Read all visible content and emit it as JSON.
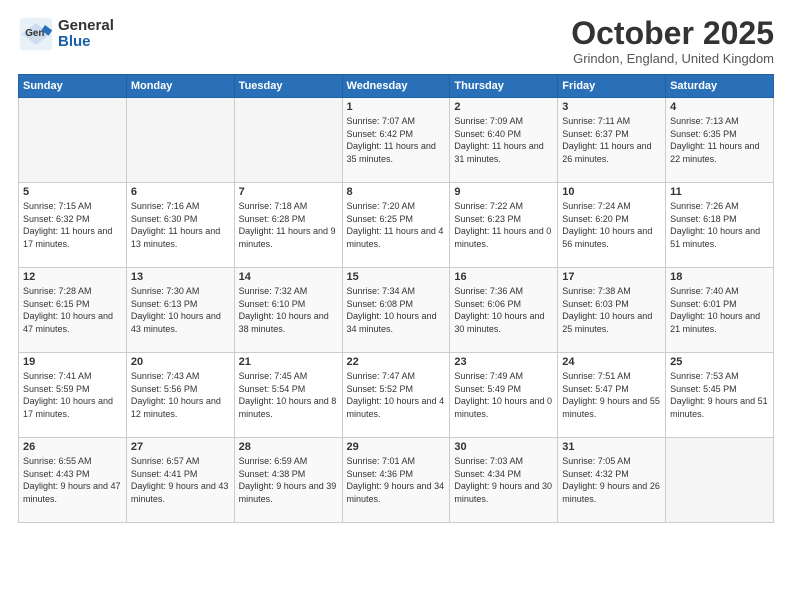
{
  "header": {
    "logo_general": "General",
    "logo_blue": "Blue",
    "month_title": "October 2025",
    "location": "Grindon, England, United Kingdom"
  },
  "days_of_week": [
    "Sunday",
    "Monday",
    "Tuesday",
    "Wednesday",
    "Thursday",
    "Friday",
    "Saturday"
  ],
  "weeks": [
    [
      {
        "day": "",
        "sunrise": "",
        "sunset": "",
        "daylight": ""
      },
      {
        "day": "",
        "sunrise": "",
        "sunset": "",
        "daylight": ""
      },
      {
        "day": "",
        "sunrise": "",
        "sunset": "",
        "daylight": ""
      },
      {
        "day": "1",
        "sunrise": "Sunrise: 7:07 AM",
        "sunset": "Sunset: 6:42 PM",
        "daylight": "Daylight: 11 hours and 35 minutes."
      },
      {
        "day": "2",
        "sunrise": "Sunrise: 7:09 AM",
        "sunset": "Sunset: 6:40 PM",
        "daylight": "Daylight: 11 hours and 31 minutes."
      },
      {
        "day": "3",
        "sunrise": "Sunrise: 7:11 AM",
        "sunset": "Sunset: 6:37 PM",
        "daylight": "Daylight: 11 hours and 26 minutes."
      },
      {
        "day": "4",
        "sunrise": "Sunrise: 7:13 AM",
        "sunset": "Sunset: 6:35 PM",
        "daylight": "Daylight: 11 hours and 22 minutes."
      }
    ],
    [
      {
        "day": "5",
        "sunrise": "Sunrise: 7:15 AM",
        "sunset": "Sunset: 6:32 PM",
        "daylight": "Daylight: 11 hours and 17 minutes."
      },
      {
        "day": "6",
        "sunrise": "Sunrise: 7:16 AM",
        "sunset": "Sunset: 6:30 PM",
        "daylight": "Daylight: 11 hours and 13 minutes."
      },
      {
        "day": "7",
        "sunrise": "Sunrise: 7:18 AM",
        "sunset": "Sunset: 6:28 PM",
        "daylight": "Daylight: 11 hours and 9 minutes."
      },
      {
        "day": "8",
        "sunrise": "Sunrise: 7:20 AM",
        "sunset": "Sunset: 6:25 PM",
        "daylight": "Daylight: 11 hours and 4 minutes."
      },
      {
        "day": "9",
        "sunrise": "Sunrise: 7:22 AM",
        "sunset": "Sunset: 6:23 PM",
        "daylight": "Daylight: 11 hours and 0 minutes."
      },
      {
        "day": "10",
        "sunrise": "Sunrise: 7:24 AM",
        "sunset": "Sunset: 6:20 PM",
        "daylight": "Daylight: 10 hours and 56 minutes."
      },
      {
        "day": "11",
        "sunrise": "Sunrise: 7:26 AM",
        "sunset": "Sunset: 6:18 PM",
        "daylight": "Daylight: 10 hours and 51 minutes."
      }
    ],
    [
      {
        "day": "12",
        "sunrise": "Sunrise: 7:28 AM",
        "sunset": "Sunset: 6:15 PM",
        "daylight": "Daylight: 10 hours and 47 minutes."
      },
      {
        "day": "13",
        "sunrise": "Sunrise: 7:30 AM",
        "sunset": "Sunset: 6:13 PM",
        "daylight": "Daylight: 10 hours and 43 minutes."
      },
      {
        "day": "14",
        "sunrise": "Sunrise: 7:32 AM",
        "sunset": "Sunset: 6:10 PM",
        "daylight": "Daylight: 10 hours and 38 minutes."
      },
      {
        "day": "15",
        "sunrise": "Sunrise: 7:34 AM",
        "sunset": "Sunset: 6:08 PM",
        "daylight": "Daylight: 10 hours and 34 minutes."
      },
      {
        "day": "16",
        "sunrise": "Sunrise: 7:36 AM",
        "sunset": "Sunset: 6:06 PM",
        "daylight": "Daylight: 10 hours and 30 minutes."
      },
      {
        "day": "17",
        "sunrise": "Sunrise: 7:38 AM",
        "sunset": "Sunset: 6:03 PM",
        "daylight": "Daylight: 10 hours and 25 minutes."
      },
      {
        "day": "18",
        "sunrise": "Sunrise: 7:40 AM",
        "sunset": "Sunset: 6:01 PM",
        "daylight": "Daylight: 10 hours and 21 minutes."
      }
    ],
    [
      {
        "day": "19",
        "sunrise": "Sunrise: 7:41 AM",
        "sunset": "Sunset: 5:59 PM",
        "daylight": "Daylight: 10 hours and 17 minutes."
      },
      {
        "day": "20",
        "sunrise": "Sunrise: 7:43 AM",
        "sunset": "Sunset: 5:56 PM",
        "daylight": "Daylight: 10 hours and 12 minutes."
      },
      {
        "day": "21",
        "sunrise": "Sunrise: 7:45 AM",
        "sunset": "Sunset: 5:54 PM",
        "daylight": "Daylight: 10 hours and 8 minutes."
      },
      {
        "day": "22",
        "sunrise": "Sunrise: 7:47 AM",
        "sunset": "Sunset: 5:52 PM",
        "daylight": "Daylight: 10 hours and 4 minutes."
      },
      {
        "day": "23",
        "sunrise": "Sunrise: 7:49 AM",
        "sunset": "Sunset: 5:49 PM",
        "daylight": "Daylight: 10 hours and 0 minutes."
      },
      {
        "day": "24",
        "sunrise": "Sunrise: 7:51 AM",
        "sunset": "Sunset: 5:47 PM",
        "daylight": "Daylight: 9 hours and 55 minutes."
      },
      {
        "day": "25",
        "sunrise": "Sunrise: 7:53 AM",
        "sunset": "Sunset: 5:45 PM",
        "daylight": "Daylight: 9 hours and 51 minutes."
      }
    ],
    [
      {
        "day": "26",
        "sunrise": "Sunrise: 6:55 AM",
        "sunset": "Sunset: 4:43 PM",
        "daylight": "Daylight: 9 hours and 47 minutes."
      },
      {
        "day": "27",
        "sunrise": "Sunrise: 6:57 AM",
        "sunset": "Sunset: 4:41 PM",
        "daylight": "Daylight: 9 hours and 43 minutes."
      },
      {
        "day": "28",
        "sunrise": "Sunrise: 6:59 AM",
        "sunset": "Sunset: 4:38 PM",
        "daylight": "Daylight: 9 hours and 39 minutes."
      },
      {
        "day": "29",
        "sunrise": "Sunrise: 7:01 AM",
        "sunset": "Sunset: 4:36 PM",
        "daylight": "Daylight: 9 hours and 34 minutes."
      },
      {
        "day": "30",
        "sunrise": "Sunrise: 7:03 AM",
        "sunset": "Sunset: 4:34 PM",
        "daylight": "Daylight: 9 hours and 30 minutes."
      },
      {
        "day": "31",
        "sunrise": "Sunrise: 7:05 AM",
        "sunset": "Sunset: 4:32 PM",
        "daylight": "Daylight: 9 hours and 26 minutes."
      },
      {
        "day": "",
        "sunrise": "",
        "sunset": "",
        "daylight": ""
      }
    ]
  ]
}
